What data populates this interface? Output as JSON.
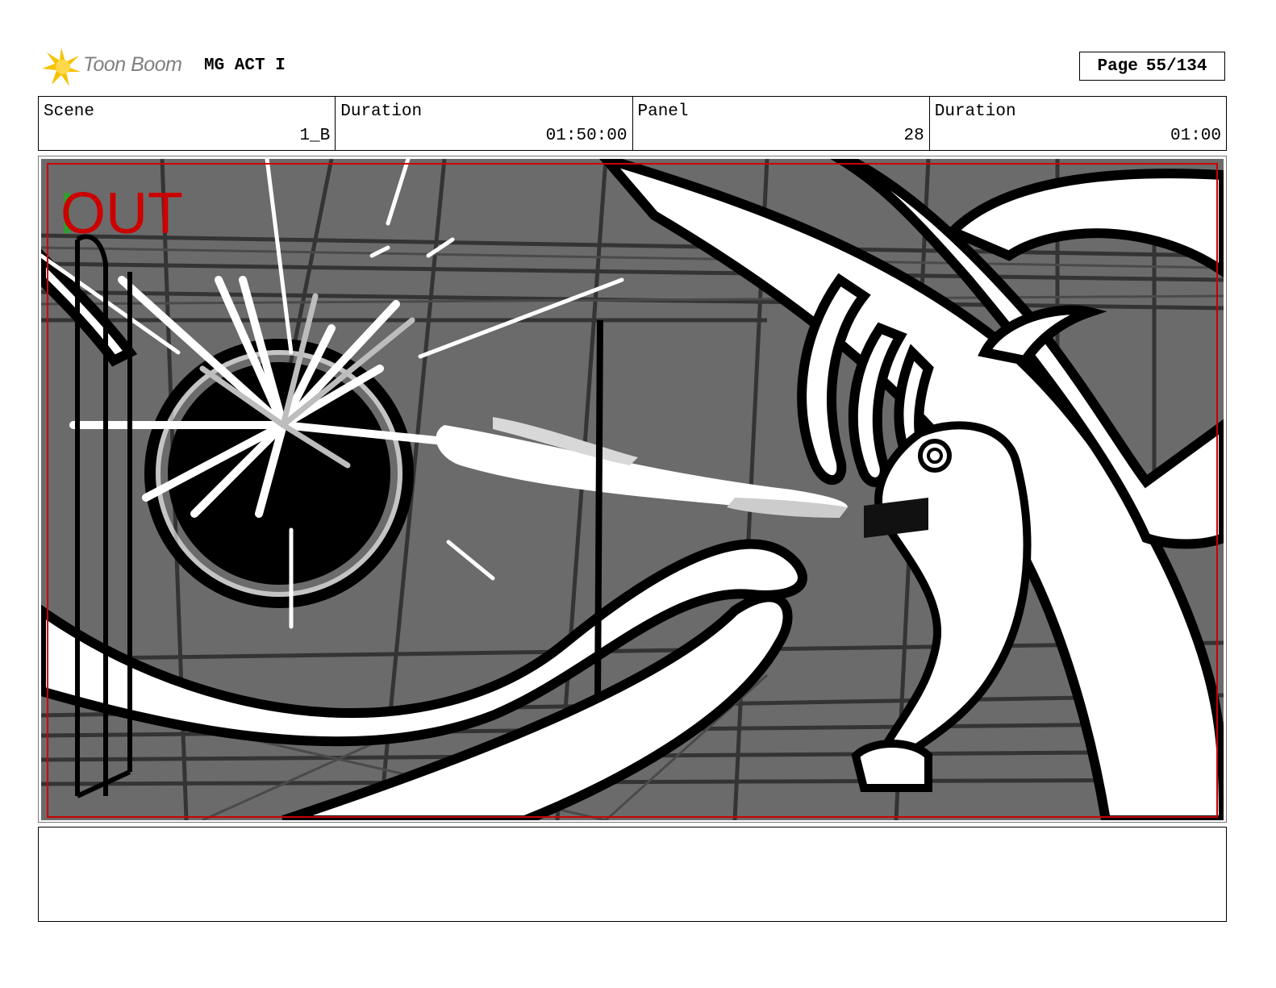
{
  "header": {
    "logo_text": "Toon Boom",
    "project_title": "MG ACT I",
    "page_label": "Page",
    "page_number": "55/134"
  },
  "info": {
    "scene_label": "Scene",
    "scene_value": "1_B",
    "duration_label": "Duration",
    "duration_value": "01:50:00",
    "panel_label": "Panel",
    "panel_value": "28",
    "panel_duration_label": "Duration",
    "panel_duration_value": "01:00"
  },
  "panel_image": {
    "overlay_text": "OUT",
    "overlay_color": "#cc0000",
    "accent_color": "#22aa22",
    "safe_frame_color": "#cc0000"
  },
  "notes": {
    "text": ""
  }
}
